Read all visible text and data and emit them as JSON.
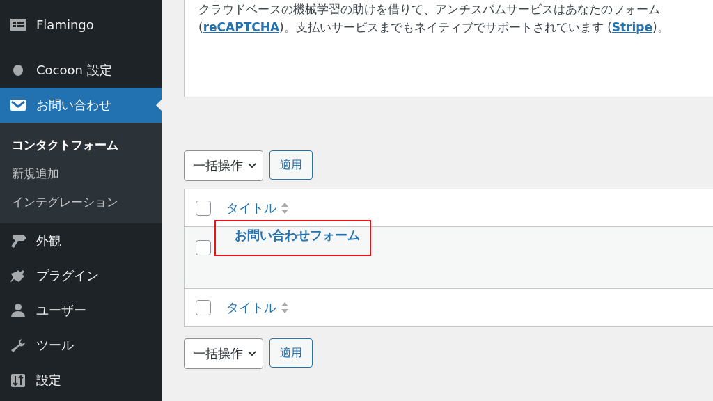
{
  "sidebar": {
    "items": [
      {
        "label": "Flamingo",
        "kind": "flamingo",
        "selected": false
      },
      {
        "label": "Cocoon 設定",
        "kind": "cocoon",
        "selected": false
      },
      {
        "label": "お問い合わせ",
        "kind": "mail",
        "selected": true,
        "children": [
          {
            "label": "コンタクトフォーム",
            "selected": true
          },
          {
            "label": "新規追加",
            "selected": false
          },
          {
            "label": "インテグレーション",
            "selected": false
          }
        ]
      },
      {
        "label": "外観",
        "kind": "brush",
        "selected": false
      },
      {
        "label": "プラグイン",
        "kind": "plug",
        "selected": false
      },
      {
        "label": "ユーザー",
        "kind": "user",
        "selected": false
      },
      {
        "label": "ツール",
        "kind": "wrench",
        "selected": false
      },
      {
        "label": "設定",
        "kind": "settings",
        "selected": false
      }
    ]
  },
  "notice": {
    "lines": [
      [
        {
          "text": "クラウドベースの機械学習の助けを借りて、アンチスパムサービスはあなたのフォーム"
        }
      ],
      [
        {
          "text": "("
        },
        {
          "text": "reCAPTCHA",
          "kind": "link"
        },
        {
          "text": ")。支払いサービスまでもネイティブでサポートされています ("
        },
        {
          "text": "Stripe",
          "kind": "link"
        },
        {
          "text": ")。"
        }
      ]
    ]
  },
  "bulk_top": {
    "action": "一括操作",
    "apply": "適用"
  },
  "table": {
    "header": {
      "title": "タイトル",
      "checked": false
    },
    "rows": [
      {
        "title": "お問い合わせフォーム",
        "checked": false,
        "highlighted": true
      }
    ],
    "footer": {
      "title": "タイトル",
      "checked": false
    }
  },
  "bulk_bottom": {
    "action": "一括操作",
    "apply": "適用"
  }
}
